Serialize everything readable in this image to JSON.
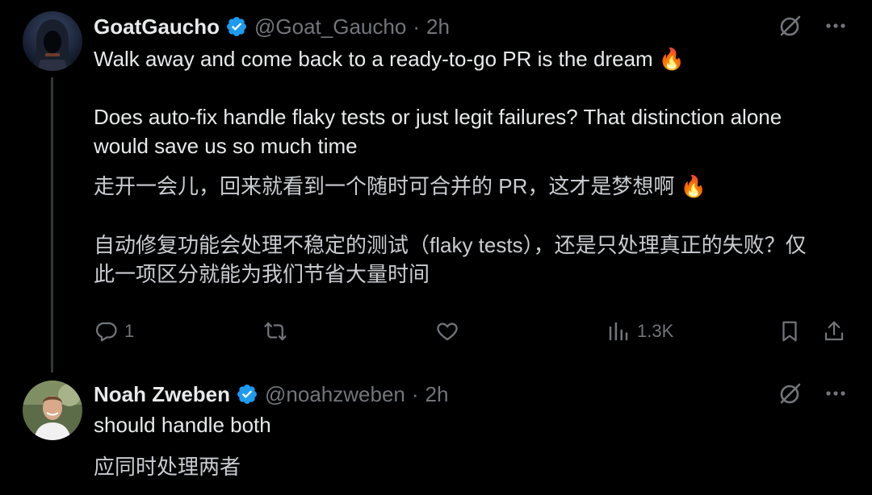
{
  "colors": {
    "background": "#000000",
    "text": "#e7e9ea",
    "muted": "#71767b",
    "verified": "#1d9bf0",
    "thread_line": "#333639"
  },
  "post": {
    "author_name": "GoatGaucho",
    "handle": "@Goat_Gaucho",
    "separator": "·",
    "time": "2h",
    "verified_icon": "verified-badge-icon",
    "text_line1": "Walk away and come back to a ready-to-go PR is the dream 🔥",
    "text_line2": "Does auto-fix handle flaky tests or just legit failures? That distinction alone\nwould save us so much time",
    "translation_line1": "走开一会儿，回来就看到一个随时可合并的 PR，这才是梦想啊 🔥",
    "translation_line2": "自动修复功能会处理不稳定的测试（flaky tests），还是只处理真正的失败？仅\n此一项区分就能为我们节省大量时间",
    "actions": {
      "replies": "1",
      "retweets": "",
      "likes": "",
      "views": "1.3K"
    }
  },
  "reply": {
    "author_name": "Noah Zweben",
    "handle": "@noahzweben",
    "separator": "·",
    "time": "2h",
    "verified_icon": "verified-badge-icon",
    "text": "should handle both",
    "translation": "应同时处理两者"
  }
}
